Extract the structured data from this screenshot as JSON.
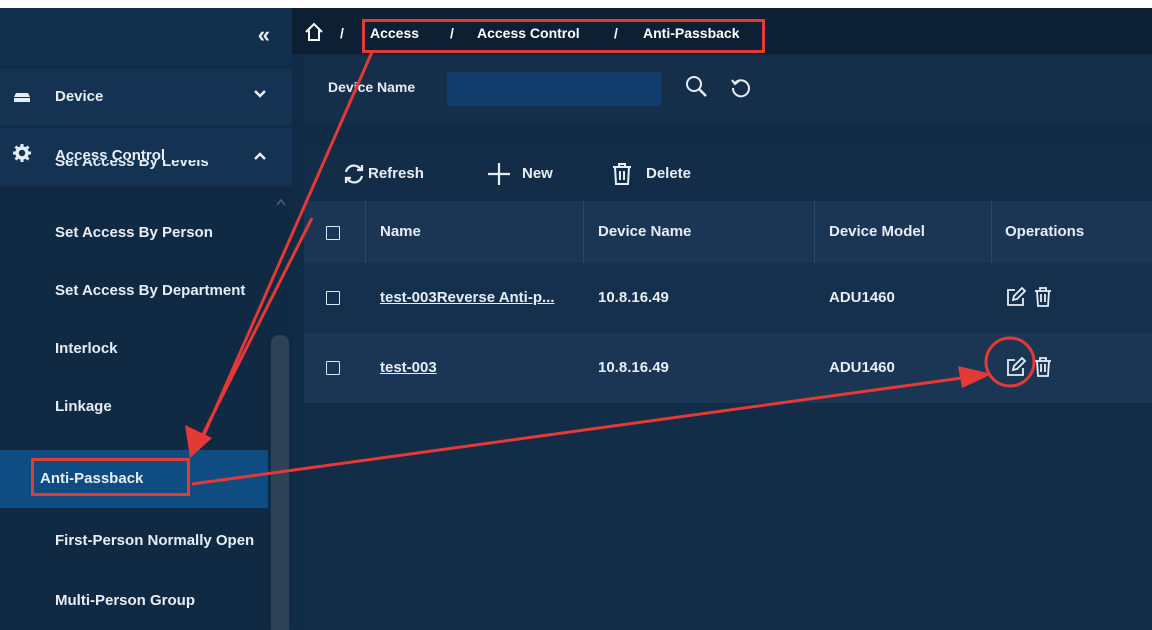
{
  "sidebar": {
    "collapse_icon": "double-chevron-left-icon",
    "menus": [
      {
        "label": "Device",
        "icon": "device-icon",
        "expanded": false
      },
      {
        "label": "Access Control",
        "icon": "gear-icon",
        "expanded": true
      }
    ],
    "partial_item": "Set Access By Levels",
    "items": [
      {
        "label": "Set Access By Person"
      },
      {
        "label": "Set Access By Department"
      },
      {
        "label": "Interlock"
      },
      {
        "label": "Linkage"
      },
      {
        "label": "Anti-Passback",
        "active": true
      },
      {
        "label": "First-Person Normally Open"
      },
      {
        "label": "Multi-Person Group"
      }
    ]
  },
  "breadcrumb": {
    "home_icon": "home-icon",
    "items": [
      "Access",
      "Access Control",
      "Anti-Passback"
    ],
    "separator": "/"
  },
  "filter": {
    "device_name_label": "Device Name",
    "device_name_value": "",
    "search_icon": "search-icon",
    "reset_icon": "reset-icon"
  },
  "toolbar": {
    "refresh_label": "Refresh",
    "new_label": "New",
    "delete_label": "Delete"
  },
  "table": {
    "columns": [
      "Name",
      "Device Name",
      "Device Model",
      "Operations"
    ],
    "rows": [
      {
        "name": "test-003Reverse Anti-p...",
        "device_name": "10.8.16.49",
        "device_model": "ADU1460"
      },
      {
        "name": "test-003",
        "device_name": "10.8.16.49",
        "device_model": "ADU1460"
      }
    ],
    "row_icons": [
      "edit-icon",
      "trash-icon"
    ]
  },
  "colors": {
    "sidebar_bg": "#112a43",
    "active_item_bg": "#0f4c82",
    "annotation": "#e53935"
  }
}
